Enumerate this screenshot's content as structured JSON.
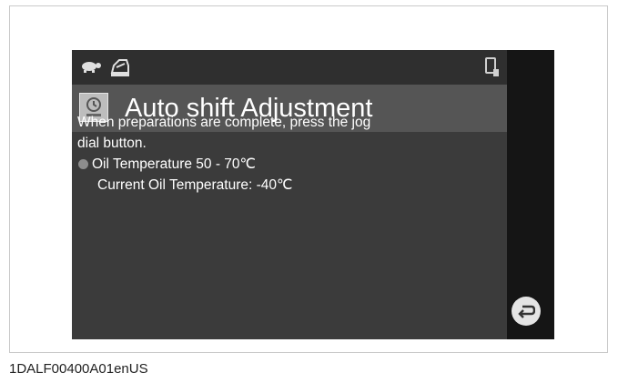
{
  "screen": {
    "title": "Auto shift Adjustment",
    "instruction_line1": "When preparations are complete, press the jog",
    "instruction_line2": "dial button.",
    "condition_label": "Oil Temperature 50 - 70℃",
    "current_label": "Current Oil Temperature: -40℃"
  },
  "icons": {
    "status_left": "turtle-icon",
    "status_engine": "engine-icon",
    "status_right": "device-icon",
    "title": "auto-shift-icon",
    "bullet": "bullet-icon",
    "back": "back-arrow-icon"
  },
  "colors": {
    "screen_bg": "#121212",
    "title_bar": "#555555",
    "content_bg": "#3b3b3b",
    "text": "#ffffff"
  },
  "caption": "1DALF00400A01enUS"
}
